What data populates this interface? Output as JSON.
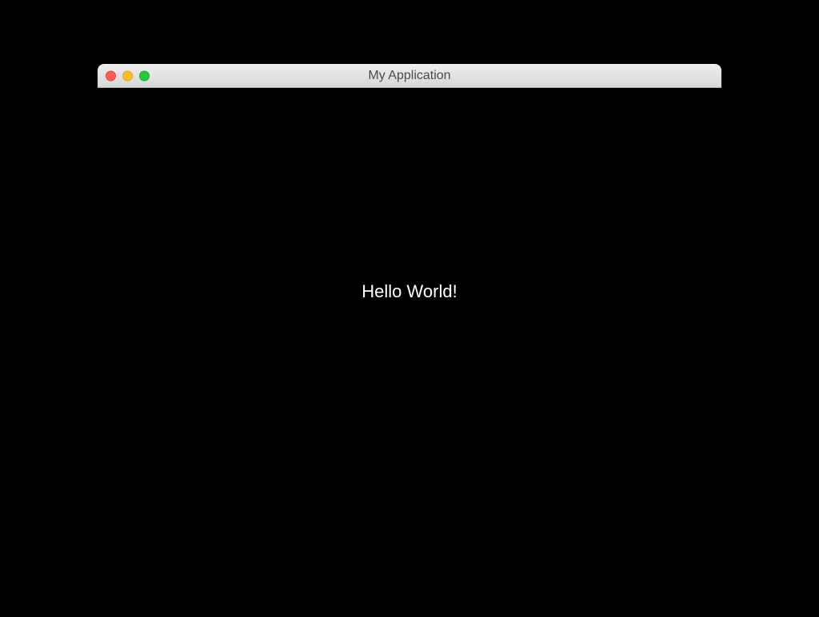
{
  "window": {
    "title": "My Application"
  },
  "content": {
    "message": "Hello World!"
  }
}
